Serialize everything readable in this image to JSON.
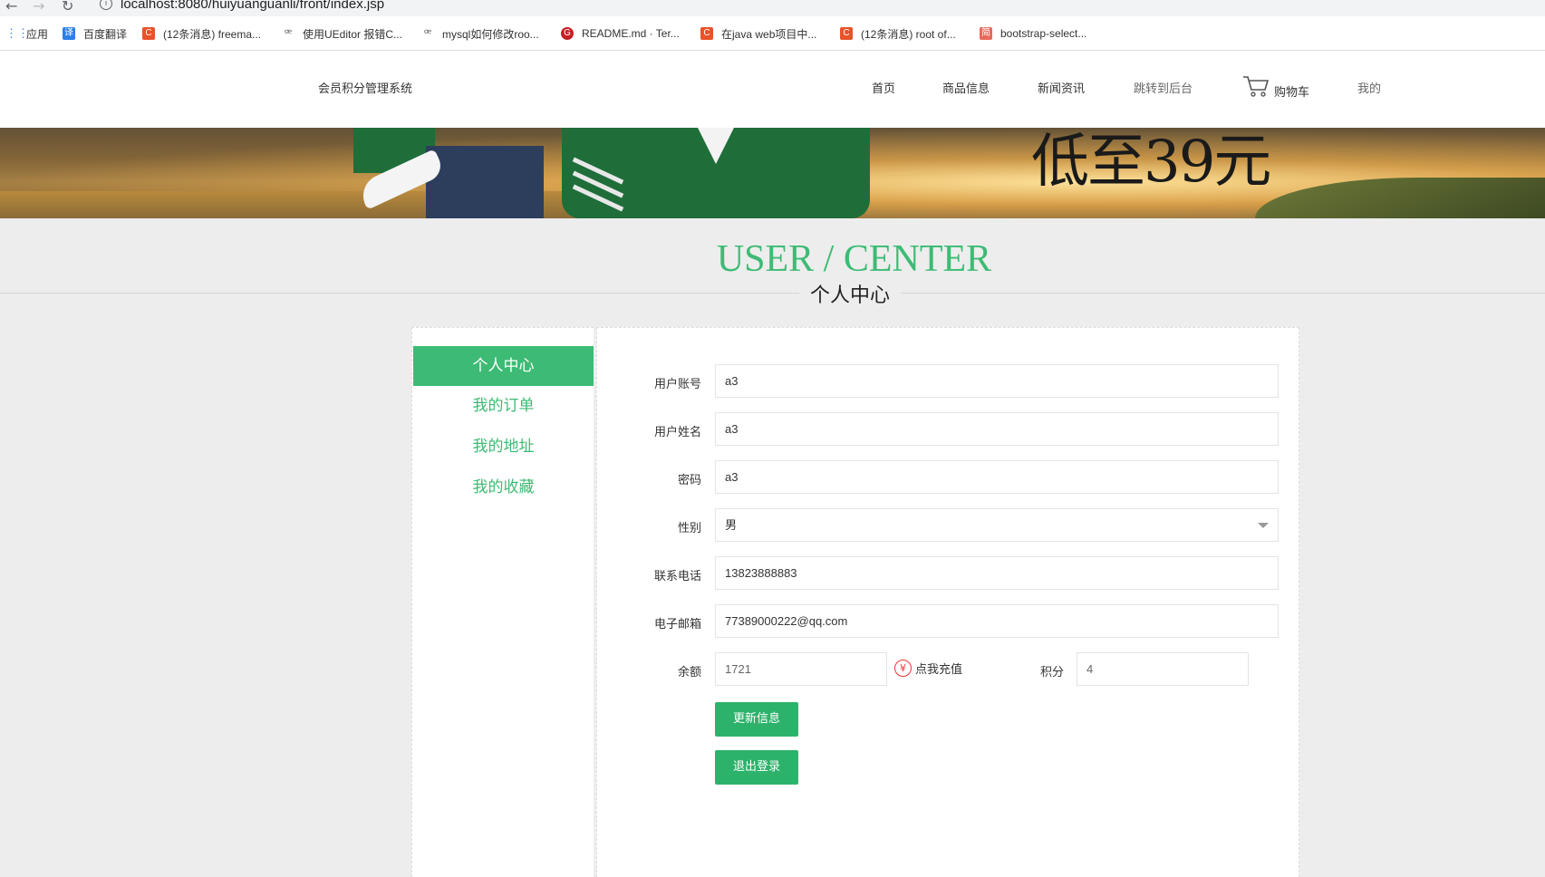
{
  "browser": {
    "url": "localhost:8080/huiyuanguanli/front/index.jsp",
    "bookmarks": [
      {
        "label": "应用",
        "icon": "apps-grid-icon"
      },
      {
        "label": "百度翻译",
        "icon": "baidu-translate-icon"
      },
      {
        "label": "(12条消息) freema...",
        "icon": "csdn-icon"
      },
      {
        "label": "使用UEditor 报错C...",
        "icon": "bookmark-icon"
      },
      {
        "label": "mysql如何修改roo...",
        "icon": "bookmark-icon"
      },
      {
        "label": "README.md · Ter...",
        "icon": "gitee-icon"
      },
      {
        "label": "在java web项目中...",
        "icon": "csdn-icon"
      },
      {
        "label": "(12条消息) root of...",
        "icon": "csdn-icon"
      },
      {
        "label": "bootstrap-select...",
        "icon": "jianshu-icon"
      }
    ]
  },
  "header": {
    "site_title": "会员积分管理系统",
    "nav": [
      "首页",
      "商品信息",
      "新闻资讯",
      "跳转到后台",
      "购物车",
      "我的"
    ]
  },
  "banner": {
    "text": "低至39元"
  },
  "section": {
    "title_en": "USER / CENTER",
    "title_cn": "个人中心"
  },
  "sidebar": {
    "items": [
      "个人中心",
      "我的订单",
      "我的地址",
      "我的收藏"
    ],
    "active_index": 0
  },
  "form": {
    "account_label": "用户账号",
    "account_value": "a3",
    "name_label": "用户姓名",
    "name_value": "a3",
    "password_label": "密码",
    "password_value": "a3",
    "gender_label": "性别",
    "gender_value": "男",
    "phone_label": "联系电话",
    "phone_value": "13823888883",
    "email_label": "电子邮箱",
    "email_value": "77389000222@qq.com",
    "balance_label": "余额",
    "balance_value": "1721",
    "recharge_label": "点我充值",
    "points_label": "积分",
    "points_value": "4",
    "update_button": "更新信息",
    "logout_button": "退出登录"
  },
  "colors": {
    "accent": "#3dbb74",
    "button": "#2db26b",
    "recharge_icon": "#e33333"
  }
}
